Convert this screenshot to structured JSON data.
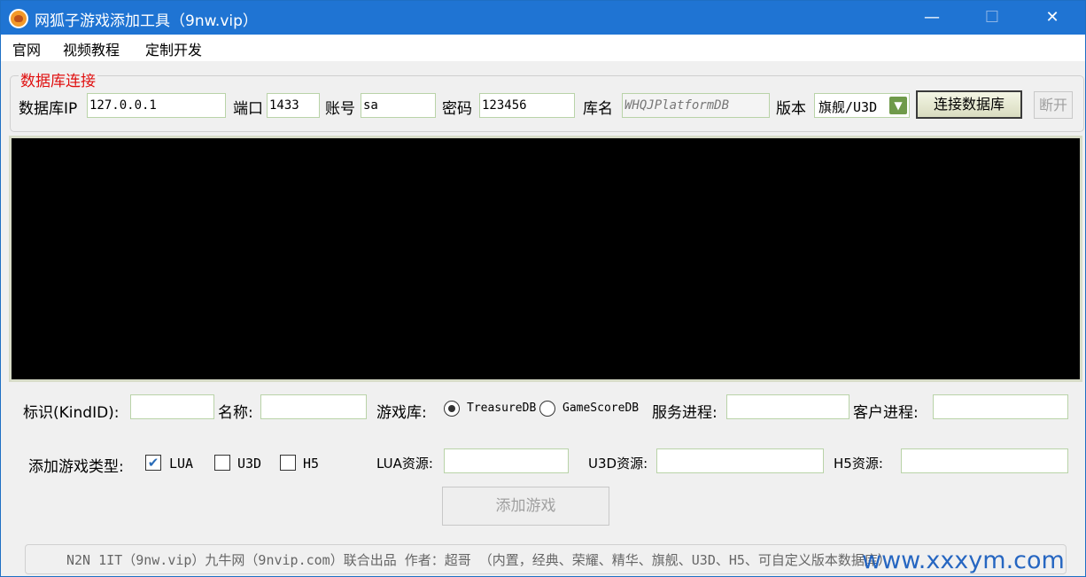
{
  "window": {
    "title": "网狐子游戏添加工具（9nw.vip）"
  },
  "menu": [
    "官网",
    "视频教程",
    "定制开发"
  ],
  "db_group": {
    "legend": "数据库连接",
    "ip_label": "数据库IP",
    "ip_value": "127.0.0.1",
    "port_label": "端口",
    "port_value": "1433",
    "account_label": "账号",
    "account_value": "sa",
    "password_label": "密码",
    "password_value": "123456",
    "dbname_label": "库名",
    "dbname_value": "WHQJPlatformDB",
    "version_label": "版本",
    "version_value": "旗舰/U3D",
    "connect_label": "连接数据库",
    "disconnect_label": "断开"
  },
  "form": {
    "kind_label": "标识(KindID):",
    "kind_value": "",
    "name_label": "名称:",
    "name_value": "",
    "gamedb_label": "游戏库:",
    "gamedb_options": [
      "TreasureDB",
      "GameScoreDB"
    ],
    "gamedb_selected": "TreasureDB",
    "server_label": "服务进程:",
    "server_value": "",
    "client_label": "客户进程:",
    "client_value": "",
    "type_label": "添加游戏类型:",
    "types": [
      {
        "label": "LUA",
        "checked": true
      },
      {
        "label": "U3D",
        "checked": false
      },
      {
        "label": "H5",
        "checked": false
      }
    ],
    "lua_res_label": "LUA资源:",
    "u3d_res_label": "U3D资源:",
    "h5_res_label": "H5资源:",
    "add_label": "添加游戏"
  },
  "footer": {
    "text": "N2N 1IT（9nw.vip）九牛网（9nvip.com）联合出品   作者：超哥 （内置，经典、荣耀、精华、旗舰、U3D、H5、可自定义版本数据库）"
  },
  "watermark": "www.xxxym.com",
  "colors": {
    "titlebar": "#1f74d3",
    "legend": "#e01010",
    "console": "#000000"
  }
}
